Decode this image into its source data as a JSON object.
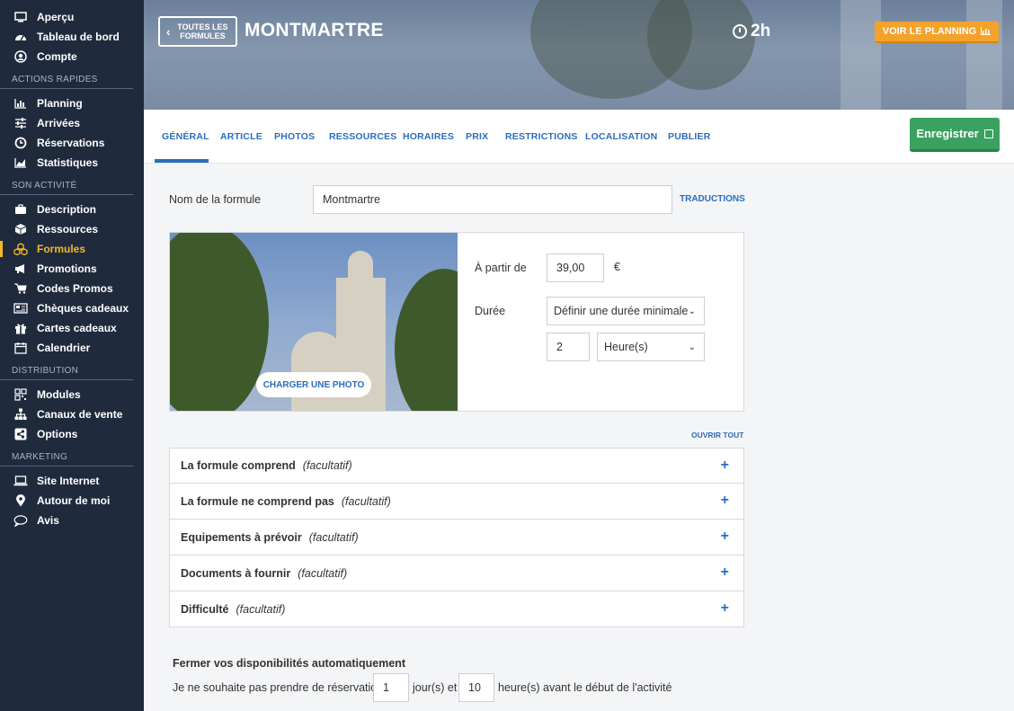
{
  "sidebar": {
    "top_items": [
      {
        "label": "Aperçu",
        "icon": "monitor-icon"
      },
      {
        "label": "Tableau de bord",
        "icon": "dashboard-icon"
      },
      {
        "label": "Compte",
        "icon": "user-icon"
      }
    ],
    "sections": [
      {
        "title": "ACTIONS RAPIDES",
        "items": [
          {
            "label": "Planning",
            "icon": "bar-chart-icon"
          },
          {
            "label": "Arrivées",
            "icon": "sliders-icon"
          },
          {
            "label": "Réservations",
            "icon": "clock-icon"
          },
          {
            "label": "Statistiques",
            "icon": "area-chart-icon"
          }
        ]
      },
      {
        "title": "SON ACTIVITÉ",
        "items": [
          {
            "label": "Description",
            "icon": "briefcase-icon"
          },
          {
            "label": "Ressources",
            "icon": "cube-icon"
          },
          {
            "label": "Formules",
            "icon": "cubes-icon",
            "active": true
          },
          {
            "label": "Promotions",
            "icon": "megaphone-icon"
          },
          {
            "label": "Codes Promos",
            "icon": "cart-icon"
          },
          {
            "label": "Chèques cadeaux",
            "icon": "voucher-icon"
          },
          {
            "label": "Cartes cadeaux",
            "icon": "gift-icon"
          },
          {
            "label": "Calendrier",
            "icon": "calendar-icon"
          }
        ]
      },
      {
        "title": "DISTRIBUTION",
        "items": [
          {
            "label": "Modules",
            "icon": "qr-icon"
          },
          {
            "label": "Canaux de vente",
            "icon": "sitemap-icon"
          },
          {
            "label": "Options",
            "icon": "share-icon"
          }
        ]
      },
      {
        "title": "MARKETING",
        "items": [
          {
            "label": "Site Internet",
            "icon": "laptop-icon"
          },
          {
            "label": "Autour de moi",
            "icon": "map-marker-icon"
          },
          {
            "label": "Avis",
            "icon": "speech-bubble-icon"
          }
        ]
      }
    ],
    "active_color": "#f1b82d"
  },
  "header": {
    "back_label": "TOUTES LES FORMULES",
    "title": "MONTMARTRE",
    "duration": "2h",
    "planning_label": "VOIR LE PLANNING"
  },
  "tabs": {
    "items": [
      "GÉNÉRAL",
      "ARTICLE",
      "PHOTOS",
      "RESSOURCES",
      "HORAIRES",
      "PRIX",
      "RESTRICTIONS",
      "LOCALISATION",
      "PUBLIER"
    ],
    "active": "GÉNÉRAL",
    "save_label": "Enregistrer"
  },
  "form": {
    "name_label": "Nom de la formule",
    "name_value": "Montmartre",
    "translations_label": "TRADUCTIONS",
    "upload_photo_label": "CHARGER UNE PHOTO",
    "price_label": "À partir de",
    "price_value": "39,00",
    "currency": "€",
    "duration_label": "Durée",
    "duration_mode": "Définir une durée minimale",
    "duration_value": "2",
    "duration_unit": "Heure(s)",
    "open_all_label": "OUVRIR TOUT"
  },
  "accordion": [
    {
      "title": "La formule comprend",
      "optional": "(facultatif)"
    },
    {
      "title": "La formule ne comprend pas",
      "optional": "(facultatif)"
    },
    {
      "title": "Equipements à prévoir",
      "optional": "(facultatif)"
    },
    {
      "title": "Documents à fournir",
      "optional": "(facultatif)"
    },
    {
      "title": "Difficulté",
      "optional": "(facultatif)"
    }
  ],
  "availability": {
    "title": "Fermer vos disponibilités automatiquement",
    "text_before": "Je ne souhaite pas prendre de réservation",
    "days_value": "1",
    "text_middle": "jour(s) et",
    "hours_value": "10",
    "text_after": "heure(s) avant le début de l'activité"
  },
  "colors": {
    "sidebar_bg": "#1f2b3d",
    "accent_blue": "#2a6ebd",
    "save_green": "#3aa160",
    "planning_orange": "#f4a22a"
  }
}
